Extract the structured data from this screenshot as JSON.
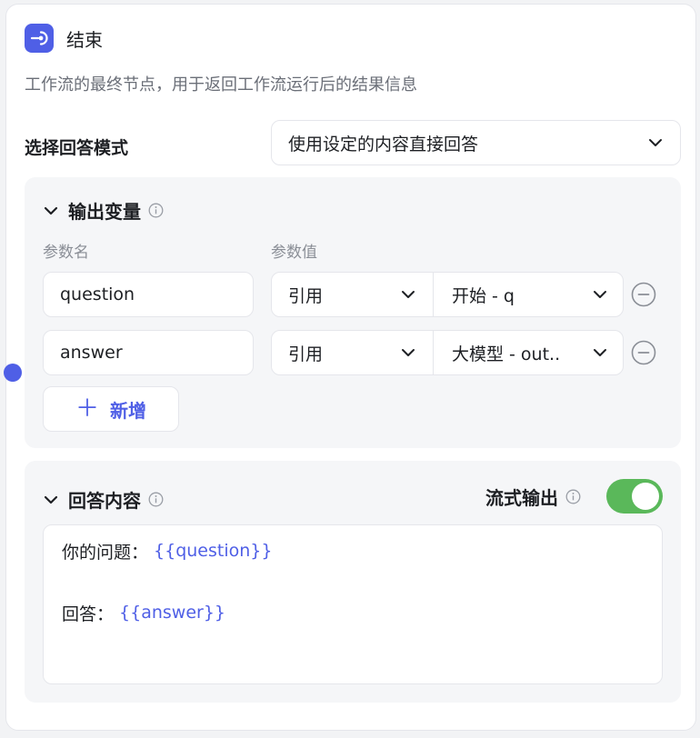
{
  "node": {
    "title": "结束",
    "description": "工作流的最终节点，用于返回工作流运行后的结果信息"
  },
  "answer_mode": {
    "label": "选择回答模式",
    "selected": "使用设定的内容直接回答"
  },
  "output_vars": {
    "title": "输出变量",
    "col_name": "参数名",
    "col_value": "参数值",
    "rows": [
      {
        "name": "question",
        "ref_type": "引用",
        "ref_value": "开始 - q"
      },
      {
        "name": "answer",
        "ref_type": "引用",
        "ref_value": "大模型 - out.."
      }
    ],
    "add_label": "新增"
  },
  "answer_content": {
    "title": "回答内容",
    "stream_label": "流式输出",
    "stream_enabled": true,
    "lines": [
      {
        "prefix": "你的问题：",
        "variable": "{{question}}"
      },
      {
        "prefix": "回答：",
        "variable": "{{answer}}"
      }
    ]
  },
  "colors": {
    "accent": "#4f5fe6",
    "toggle_on": "#5ab85a"
  },
  "icons": [
    "end-node-icon",
    "chevron-down-icon",
    "info-icon",
    "remove-circle-icon",
    "plus-icon"
  ]
}
